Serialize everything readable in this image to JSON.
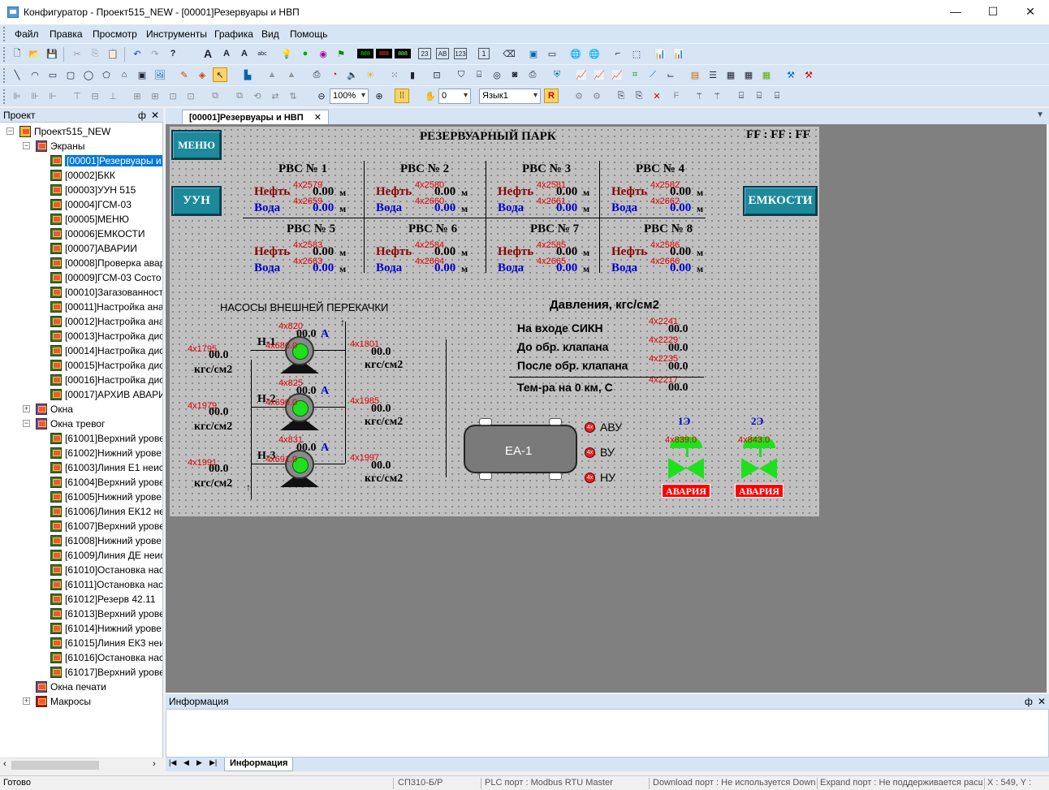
{
  "window": {
    "title": "Конфигуратор - Проект515_NEW - [00001]Резервуары и НВП",
    "min_glyph": "—",
    "max_glyph": "☐",
    "close_glyph": "✕"
  },
  "menu": [
    "Файл",
    "Правка",
    "Просмотр",
    "Инструменты",
    "Графика",
    "Вид",
    "Помощь"
  ],
  "toolbar": {
    "zoom": "100%",
    "step": "0",
    "language": "Язык1"
  },
  "project_panel": {
    "title": "Проект",
    "pin": "ф",
    "close": "✕",
    "root": "Проект515_NEW",
    "screens_label": "Экраны",
    "screens": [
      "[00001]Резервуары и",
      "[00002]БКК",
      "[00003]УУН 515",
      "[00004]ГСМ-03",
      "[00005]МЕНЮ",
      "[00006]ЕМКОСТИ",
      "[00007]АВАРИИ",
      "[00008]Проверка авар",
      "[00009]ГСМ-03 Состо",
      "[00010]Загазованност",
      "[00011]Настройка ана",
      "[00012]Настройка ана",
      "[00013]Настройка дис",
      "[00014]Настройка дис",
      "[00015]Настройка дис",
      "[00016]Настройка дис",
      "[00017]АРХИВ АВАРИ"
    ],
    "windows_label": "Окна",
    "alarm_windows_label": "Окна тревог",
    "alarm_windows": [
      "[61001]Верхний урове",
      "[61002]Нижний урове",
      "[61003]Линия Е1 неис",
      "[61004]Верхний урове",
      "[61005]Нижний урове",
      "[61006]Линия ЕК12 не",
      "[61007]Верхний урове",
      "[61008]Нижний урове",
      "[61009]Линия ДЕ неис",
      "[61010]Остановка нас",
      "[61011]Остановка нас",
      "[61012]Резерв 42.11",
      "[61013]Верхний урове",
      "[61014]Нижний урове",
      "[61015]Линия ЕК3 неи",
      "[61016]Остановка нас",
      "[61017]Верхний урове"
    ],
    "print_windows_label": "Окна печати",
    "macros_label": "Макросы"
  },
  "doc_tab": {
    "label": "[00001]Резервуары и НВП",
    "close": "✕"
  },
  "scada": {
    "title": "РЕЗЕРВУАРНЫЙ ПАРК",
    "clock": "FF : FF : FF",
    "btn_menu": "МЕНЮ",
    "btn_uun": "УУН",
    "btn_emkosti": "ЕМКОСТИ",
    "oil_label": "Нефть",
    "water_label": "Вода",
    "unit_m": "м",
    "tanks": [
      {
        "name": "РВС № 1",
        "oil_tag": "4x2579",
        "water_tag": "4x2659",
        "oil": "0.00",
        "water": "0.00"
      },
      {
        "name": "РВС № 2",
        "oil_tag": "4x2580",
        "water_tag": "4x2660",
        "oil": "0.00",
        "water": "0.00"
      },
      {
        "name": "РВС № 3",
        "oil_tag": "4x2581",
        "water_tag": "4x2661",
        "oil": "0.00",
        "water": "0.00"
      },
      {
        "name": "РВС № 4",
        "oil_tag": "4x2582",
        "water_tag": "4x2662",
        "oil": "0.00",
        "water": "0.00"
      },
      {
        "name": "РВС № 5",
        "oil_tag": "4x2583",
        "water_tag": "4x2663",
        "oil": "0.00",
        "water": "0.00"
      },
      {
        "name": "РВС № 6",
        "oil_tag": "4x2584",
        "water_tag": "4x2664",
        "oil": "0.00",
        "water": "0.00"
      },
      {
        "name": "РВС № 7",
        "oil_tag": "4x2585",
        "water_tag": "4x2665",
        "oil": "0.00",
        "water": "0.00"
      },
      {
        "name": "РВС № 8",
        "oil_tag": "4x2586",
        "water_tag": "4x2666",
        "oil": "0.00",
        "water": "0.00"
      }
    ],
    "pumps_title": "НАСОСЫ ВНЕШНЕЙ ПЕРЕКАЧКИ",
    "unit_pressure": "кгс/см2",
    "unit_amp": "А",
    "pumps": [
      {
        "name": "Н-1",
        "current_tag": "4x820",
        "current": "00.0",
        "state_tag": "4x680.0",
        "in_tag": "4x1795",
        "in_val": "00.0",
        "out_tag": "4x1801",
        "out_val": "00.0"
      },
      {
        "name": "Н-2",
        "current_tag": "4x825",
        "current": "00.0",
        "state_tag": "4x690.0",
        "in_tag": "4x1979",
        "in_val": "00.0",
        "out_tag": "4x1985",
        "out_val": "00.0"
      },
      {
        "name": "Н-3",
        "current_tag": "4x831",
        "current": "00.0",
        "state_tag": "4x691.0",
        "in_tag": "4x1991",
        "in_val": "00.0",
        "out_tag": "4x1997",
        "out_val": "00.0"
      }
    ],
    "pressure_title": "Давления,  кгс/см2",
    "pressures": [
      {
        "label": "На входе СИКН",
        "tag": "4x2241",
        "value": "00.0"
      },
      {
        "label": "До обр. клапана",
        "tag": "4x2229",
        "value": "00.0"
      },
      {
        "label": "После обр. клапана",
        "tag": "4x2235",
        "value": "00.0"
      }
    ],
    "temperature": {
      "label": "Тем-ра на 0 км, С",
      "tag": "4x2217",
      "value": "00.0"
    },
    "vessel_label": "ЕА-1",
    "led_text": "4x",
    "levels": [
      "АВУ",
      "ВУ",
      "НУ"
    ],
    "valves": [
      {
        "name": "1Э",
        "tag": "4x839.0",
        "alarm": "АВАРИЯ"
      },
      {
        "name": "2Э",
        "tag": "4x843.0",
        "alarm": "АВАРИЯ"
      }
    ]
  },
  "info_panel": {
    "title": "Информация",
    "tab": "Информация"
  },
  "status": {
    "ready": "Готово",
    "device": "СП310-Б/Р",
    "plc": "PLC порт : Modbus RTU Master",
    "download": "Download порт : Не используется Down",
    "expand": "Expand порт : Не поддерживается расш",
    "coords": "X : 549, Y :"
  }
}
